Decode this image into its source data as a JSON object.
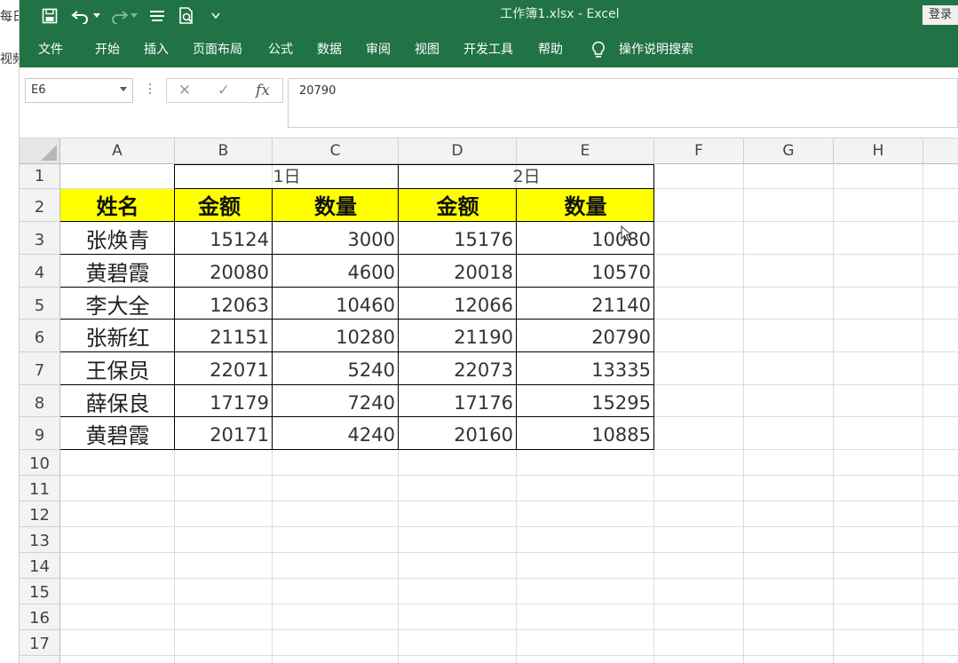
{
  "background_window": {
    "text1": "每日",
    "text2": "视频"
  },
  "titlebar": {
    "title": "工作簿1.xlsx  -  Excel",
    "login_label": "登录"
  },
  "ribbon": {
    "tabs": [
      "文件",
      "开始",
      "插入",
      "页面布局",
      "公式",
      "数据",
      "审阅",
      "视图",
      "开发工具",
      "帮助"
    ],
    "tell_me": "操作说明搜索"
  },
  "formula_bar": {
    "name_box": "E6",
    "formula": "20790"
  },
  "sheet": {
    "columns": [
      "A",
      "B",
      "C",
      "D",
      "E",
      "F",
      "G",
      "H"
    ],
    "rows": [
      "1",
      "2",
      "3",
      "4",
      "5",
      "6",
      "7",
      "8",
      "9",
      "10",
      "11",
      "12",
      "13",
      "14",
      "15",
      "16",
      "17"
    ],
    "day1": "1日",
    "day2": "2日",
    "headers": [
      "姓名",
      "金额",
      "数量",
      "金额",
      "数量"
    ],
    "data": [
      [
        "张焕青",
        "15124",
        "3000",
        "15176",
        "10080"
      ],
      [
        "黄碧霞",
        "20080",
        "4600",
        "20018",
        "10570"
      ],
      [
        "李大全",
        "12063",
        "10460",
        "12066",
        "21140"
      ],
      [
        "张新红",
        "21151",
        "10280",
        "21190",
        "20790"
      ],
      [
        "王保员",
        "22071",
        "5240",
        "22073",
        "13335"
      ],
      [
        "薛保良",
        "17179",
        "7240",
        "17176",
        "15295"
      ],
      [
        "黄碧霞",
        "20171",
        "4240",
        "20160",
        "10885"
      ]
    ]
  },
  "colors": {
    "excel_green": "#217346",
    "header_fill": "#ffff00"
  }
}
